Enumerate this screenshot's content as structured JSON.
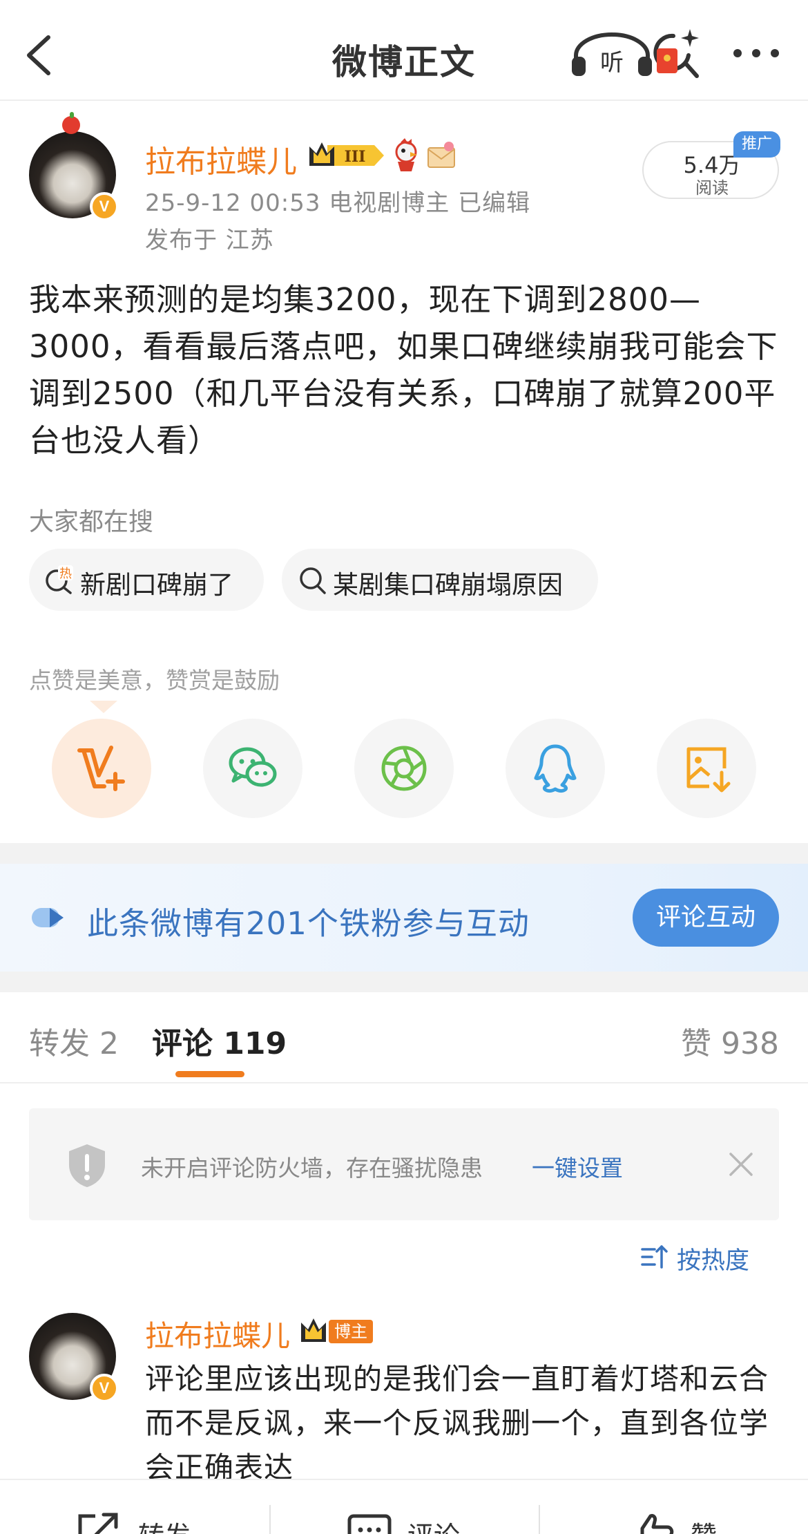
{
  "header": {
    "title": "微博正文",
    "back_icon": "chevron-left-icon",
    "listen_label": "听",
    "more_icon": "more-dots-icon"
  },
  "post": {
    "author": "拉布拉蝶儿",
    "level_badge": "III",
    "verified_mark": "V",
    "meta": "25-9-12 00:53  电视剧博主  已编辑",
    "location": "发布于 江苏",
    "read_count": "5.4万",
    "read_label": "阅读",
    "promo_tag": "推广",
    "body": "我本来预测的是均集3200，现在下调到2800—3000，看看最后落点吧，如果口碑继续崩我可能会下调到2500（和几平台没有关系，口碑崩了就算200平台也没人看）"
  },
  "search": {
    "title": "大家都在搜",
    "chips": [
      {
        "text": "新剧口碑崩了",
        "hot_mark": "热"
      },
      {
        "text": "某剧集口碑崩塌原因"
      }
    ]
  },
  "reward": {
    "hint": "点赞是美意，赞赏是鼓励",
    "share_icons": [
      "reward-v-icon",
      "wechat-icon",
      "moments-icon",
      "qq-icon",
      "save-image-icon"
    ]
  },
  "fan_banner": {
    "text": "此条微博有201个铁粉参与互动",
    "button": "评论互动"
  },
  "tabs": {
    "repost": "转发 2",
    "comments": "评论 119",
    "likes": "赞 938"
  },
  "firewall": {
    "text": "未开启评论防火墙，存在骚扰隐患",
    "link": "一键设置"
  },
  "sort": {
    "label": "按热度"
  },
  "comment": {
    "author": "拉布拉蝶儿",
    "author_tag": "博主",
    "body": "评论里应该出现的是我们会一直盯着灯塔和云合而不是反讽，来一个反讽我删一个，直到各位学会正确表达"
  },
  "bottom_bar": {
    "repost": "转发",
    "comment": "评论",
    "like": "赞"
  },
  "colors": {
    "accent_orange": "#f07c1e",
    "link_blue": "#3a74bf",
    "button_blue": "#4a8fe0"
  }
}
